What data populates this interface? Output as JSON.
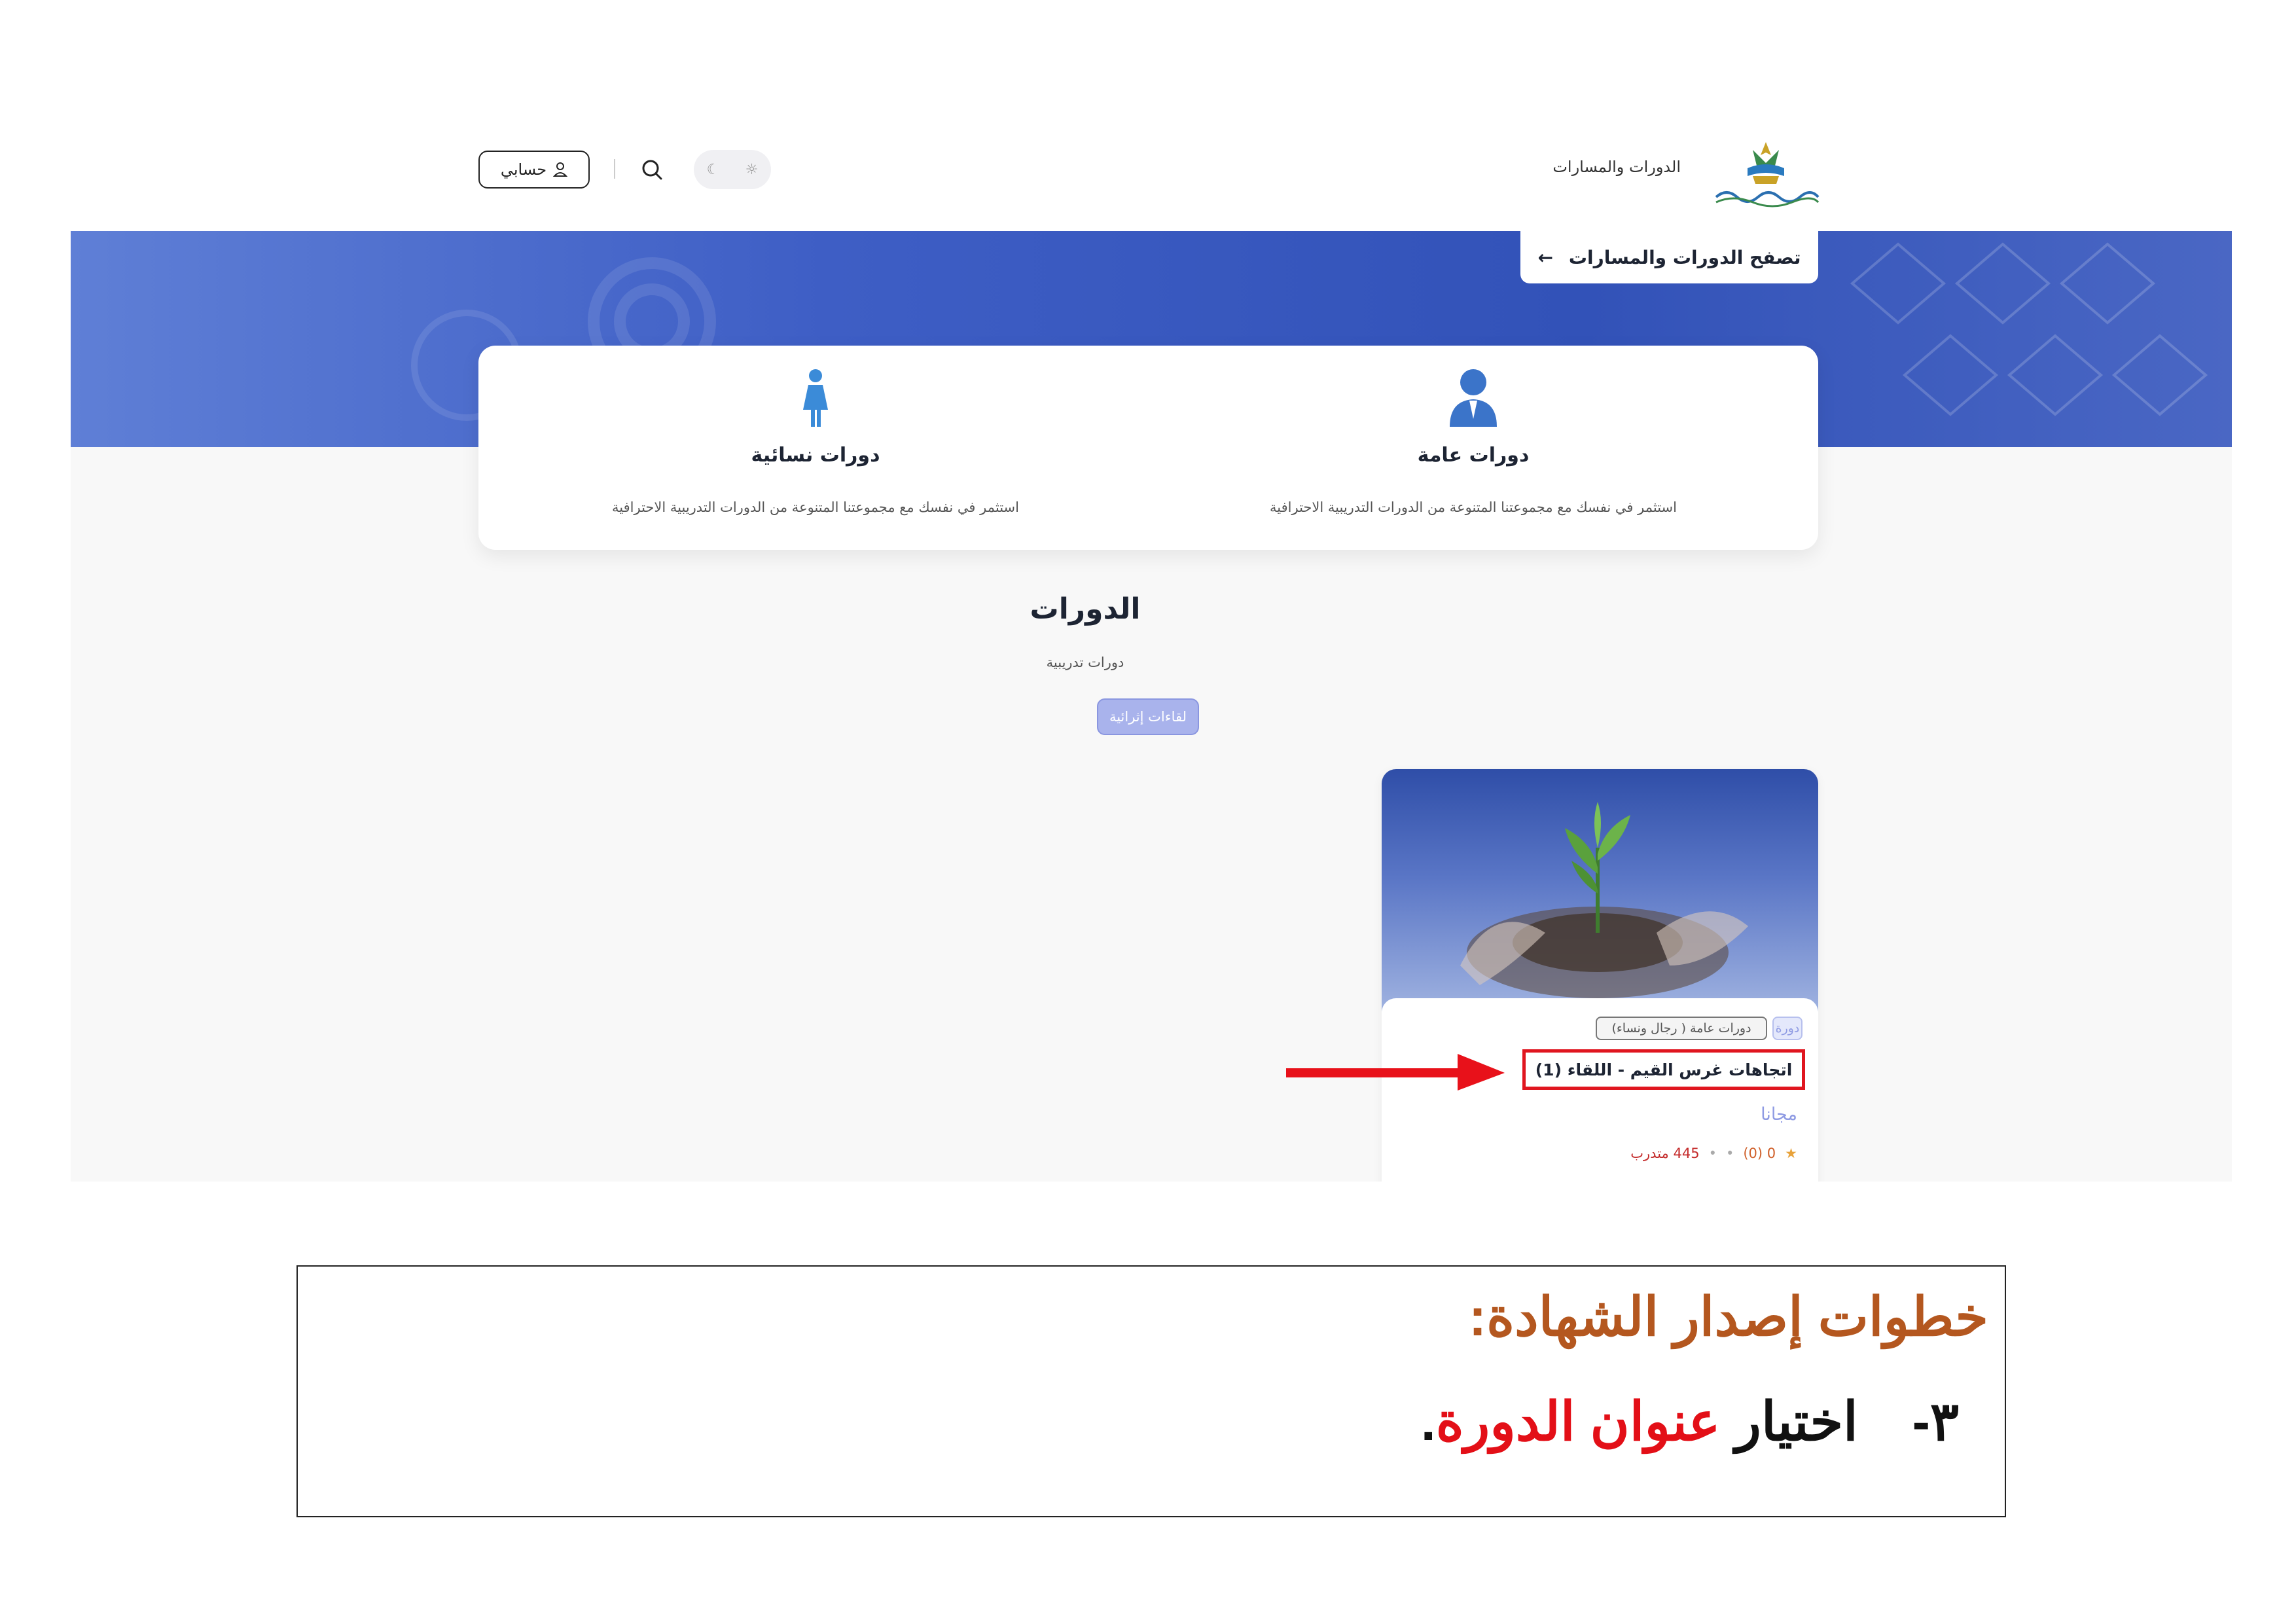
{
  "header": {
    "nav_link": "الدورات والمسارات",
    "account_label": "حسابي"
  },
  "hero": {
    "browse_button": "تصفح الدورات والمسارات"
  },
  "categories": [
    {
      "title": "دورات عامة",
      "description": "استثمر في نفسك مع مجموعتنا المتنوعة من الدورات التدريبية الاحترافية"
    },
    {
      "title": "دورات نسائية",
      "description": "استثمر في نفسك مع مجموعتنا المتنوعة من الدورات التدريبية الاحترافية"
    }
  ],
  "courses_section": {
    "title": "الدورات",
    "subtitle": "دورات تدريبية",
    "filter_button": "لقاءات إثرائية"
  },
  "course_card": {
    "tag_type": "دورة",
    "tag_category": "دورات عامة ( رجال ونساء)",
    "title": "اتجاهات غرس القيم - اللقاء (1)",
    "price": "مجانا",
    "rating": "0 (0)",
    "trainees": "445 متدرب"
  },
  "instructions": {
    "heading": "خطوات إصدار الشهادة:",
    "step_number": "٣-",
    "step_prefix": "اختيار",
    "step_highlight": "عنوان الدورة",
    "step_suffix": "."
  },
  "colors": {
    "hero_blue": "#3e5ec5",
    "heading_brown": "#b4571f",
    "highlight_red": "#e30f17",
    "accent_lavender": "#a9b3ec"
  }
}
